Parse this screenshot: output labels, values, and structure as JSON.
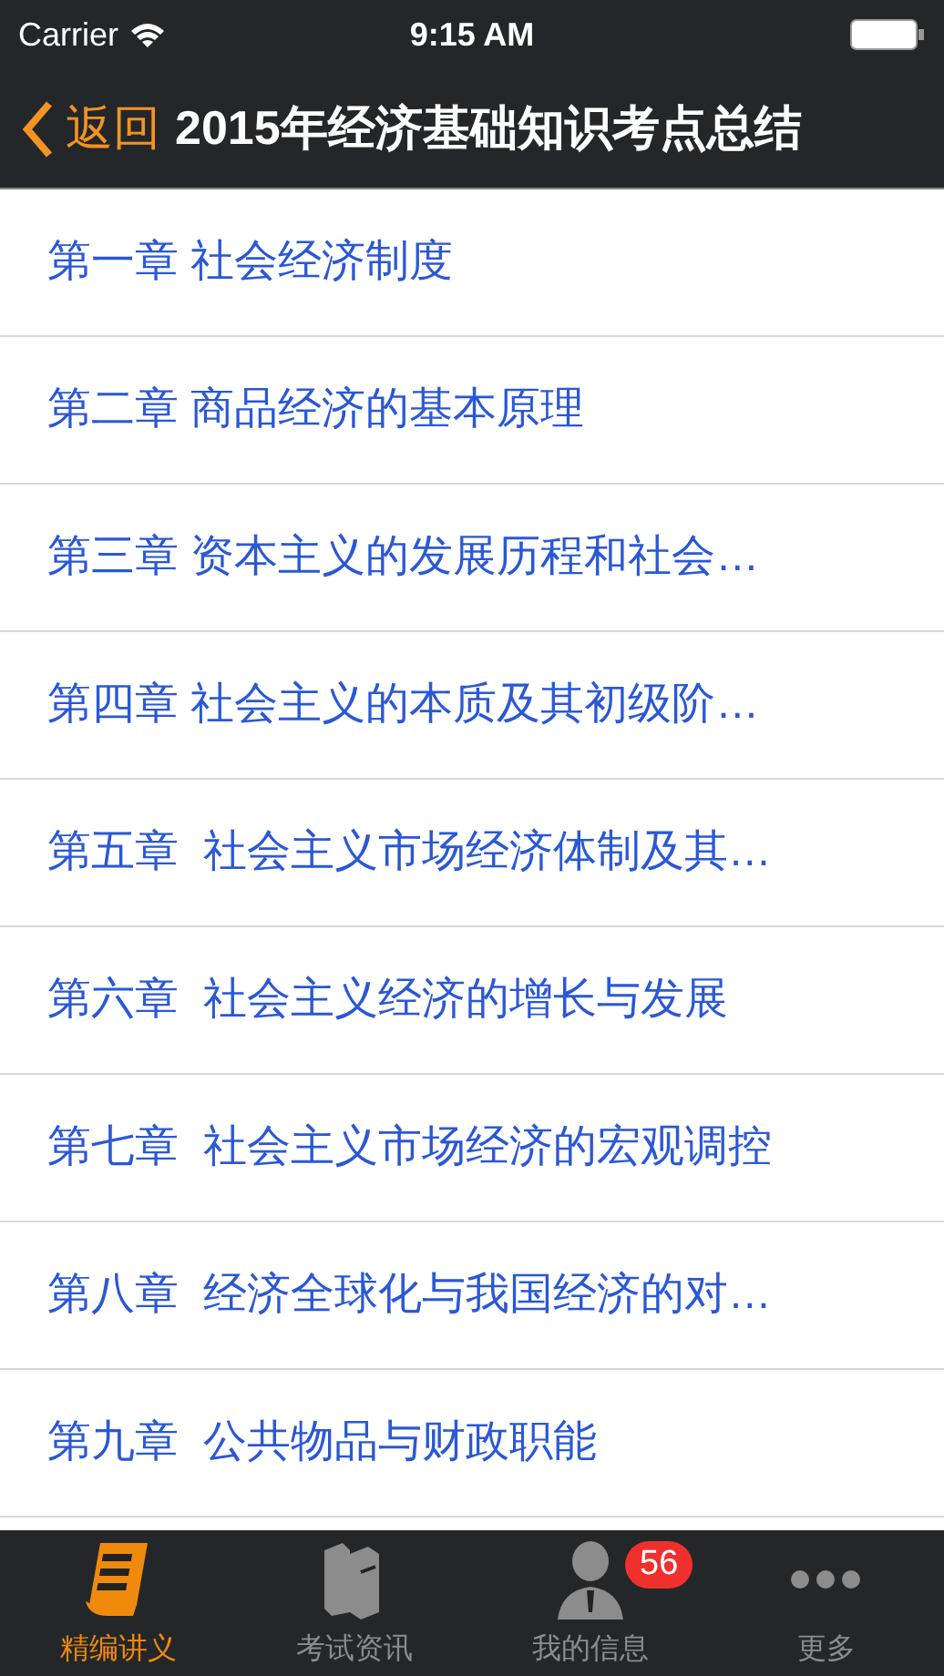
{
  "status_bar": {
    "carrier": "Carrier",
    "time": "9:15 AM"
  },
  "nav": {
    "back": "返回",
    "title": "2015年经济基础知识考点总结"
  },
  "chapters": [
    "第一章 社会经济制度",
    "第二章 商品经济的基本原理",
    "第三章 资本主义的发展历程和社会…",
    "第四章 社会主义的本质及其初级阶…",
    "第五章  社会主义市场经济体制及其…",
    "第六章  社会主义经济的增长与发展",
    "第七章  社会主义市场经济的宏观调控",
    "第八章  经济全球化与我国经济的对…",
    "第九章  公共物品与财政职能"
  ],
  "tabs": [
    {
      "label": "精编讲义",
      "kind": "notes",
      "selected": true
    },
    {
      "label": "考试资讯",
      "kind": "books",
      "selected": false
    },
    {
      "label": "我的信息",
      "kind": "person",
      "selected": false,
      "badge": "56"
    },
    {
      "label": "更多",
      "kind": "more",
      "selected": false
    }
  ]
}
